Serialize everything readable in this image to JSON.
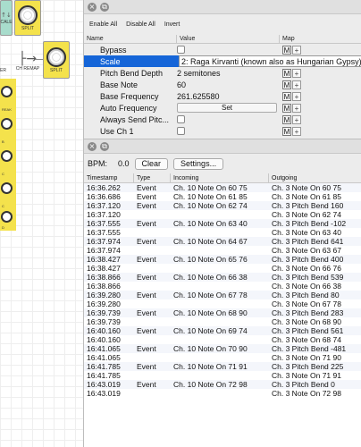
{
  "canvas": {
    "split_top_label": "SPLIT",
    "split_mid_label": "SPLIT",
    "ch_remap_label": "CH REMAP",
    "cale_label": "CALE",
    "er_label": "ER",
    "tl_arrow": "↑↓",
    "strip_labels": [
      "REAK",
      "B",
      "C",
      "C",
      "D"
    ]
  },
  "top_panel": {
    "toolbar": {
      "enable_all": "Enable All",
      "disable_all": "Disable All",
      "invert": "Invert"
    },
    "columns": {
      "name": "Name",
      "value": "Value",
      "map": "Map"
    },
    "params": [
      {
        "name": "Bypass",
        "kind": "checkbox",
        "value": ""
      },
      {
        "name": "Scale",
        "kind": "select",
        "value": "2: Raga Kirvanti (known also as Hungarian Gypsy)",
        "selected": true
      },
      {
        "name": "Pitch Bend Depth",
        "kind": "text",
        "value": "2 semitones"
      },
      {
        "name": "Base Note",
        "kind": "text",
        "value": "60"
      },
      {
        "name": "Base Frequency",
        "kind": "text",
        "value": "261.625580"
      },
      {
        "name": "Auto Frequency",
        "kind": "button",
        "value": "Set"
      },
      {
        "name": "Always Send Pitc...",
        "kind": "checkbox",
        "value": ""
      },
      {
        "name": "Use Ch 1",
        "kind": "checkbox",
        "value": ""
      }
    ],
    "map_m": "M",
    "map_plus": "+"
  },
  "bottom_panel": {
    "bpm_label": "BPM:",
    "bpm_value": "0.0",
    "clear_label": "Clear",
    "settings_label": "Settings...",
    "columns": {
      "timestamp": "Timestamp",
      "type": "Type",
      "incoming": "Incoming",
      "outgoing": "Outgoing"
    },
    "rows": [
      [
        "16:36.262",
        "Event",
        "Ch. 10 Note On 60 75",
        "Ch. 3 Note On 60 75"
      ],
      [
        "16:36.686",
        "Event",
        "Ch. 10 Note On 61 85",
        "Ch. 3 Note On 61 85"
      ],
      [
        "16:37.120",
        "Event",
        "Ch. 10 Note On 62 74",
        "Ch. 3 Pitch Bend 160"
      ],
      [
        "16:37.120",
        "",
        "",
        "Ch. 3 Note On 62 74"
      ],
      [
        "16:37.555",
        "Event",
        "Ch. 10 Note On 63 40",
        "Ch. 3 Pitch Bend -102"
      ],
      [
        "16:37.555",
        "",
        "",
        "Ch. 3 Note On 63 40"
      ],
      [
        "16:37.974",
        "Event",
        "Ch. 10 Note On 64 67",
        "Ch. 3 Pitch Bend 641"
      ],
      [
        "16:37.974",
        "",
        "",
        "Ch. 3 Note On 63 67"
      ],
      [
        "16:38.427",
        "Event",
        "Ch. 10 Note On 65 76",
        "Ch. 3 Pitch Bend 400"
      ],
      [
        "16:38.427",
        "",
        "",
        "Ch. 3 Note On 66 76"
      ],
      [
        "16:38.866",
        "Event",
        "Ch. 10 Note On 66 38",
        "Ch. 3 Pitch Bend 539"
      ],
      [
        "16:38.866",
        "",
        "",
        "Ch. 3 Note On 66 38"
      ],
      [
        "16:39.280",
        "Event",
        "Ch. 10 Note On 67 78",
        "Ch. 3 Pitch Bend 80"
      ],
      [
        "16:39.280",
        "",
        "",
        "Ch. 3 Note On 67 78"
      ],
      [
        "16:39.739",
        "Event",
        "Ch. 10 Note On 68 90",
        "Ch. 3 Pitch Bend 283"
      ],
      [
        "16:39.739",
        "",
        "",
        "Ch. 3 Note On 68 90"
      ],
      [
        "16:40.160",
        "Event",
        "Ch. 10 Note On 69 74",
        "Ch. 3 Pitch Bend 561"
      ],
      [
        "16:40.160",
        "",
        "",
        "Ch. 3 Note On 68 74"
      ],
      [
        "16:41.065",
        "Event",
        "Ch. 10 Note On 70 90",
        "Ch. 3 Pitch Bend -481"
      ],
      [
        "16:41.065",
        "",
        "",
        "Ch. 3 Note On 71 90"
      ],
      [
        "16:41.785",
        "Event",
        "Ch. 10 Note On 71 91",
        "Ch. 3 Pitch Bend 225"
      ],
      [
        "16:41.785",
        "",
        "",
        "Ch. 3 Note On 71 91"
      ],
      [
        "16:43.019",
        "Event",
        "Ch. 10 Note On 72 98",
        "Ch. 3 Pitch Bend 0"
      ],
      [
        "16:43.019",
        "",
        "",
        "Ch. 3 Note On 72 98"
      ]
    ]
  },
  "colors": {
    "selection": "#1565d8",
    "node_yellow": "#f4e24c",
    "node_teal": "#a8dccc"
  }
}
